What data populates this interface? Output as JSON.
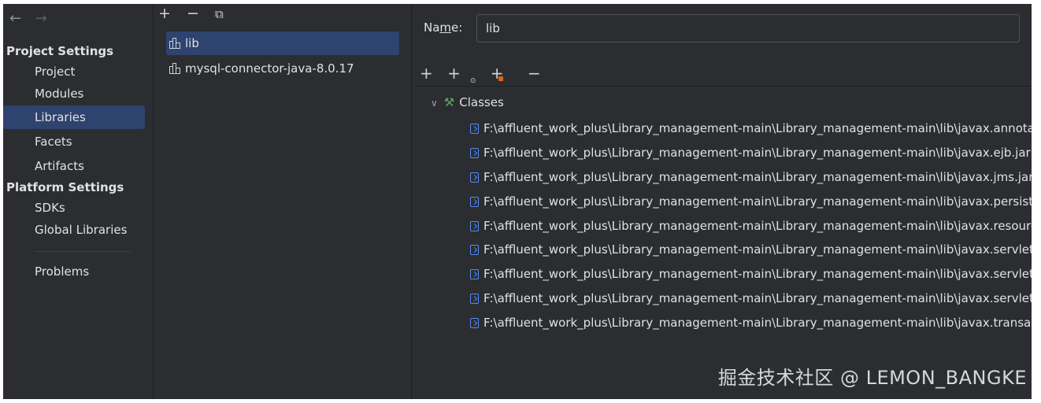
{
  "nav": {
    "back_icon": "arrow-left-icon",
    "forward_icon": "arrow-right-icon",
    "back_glyph": "←",
    "forward_glyph": "→",
    "project_settings_header": "Project Settings",
    "project_items": [
      {
        "label": "Project"
      },
      {
        "label": "Modules"
      },
      {
        "label": "Libraries",
        "selected": true
      },
      {
        "label": "Facets"
      },
      {
        "label": "Artifacts"
      }
    ],
    "platform_settings_header": "Platform Settings",
    "platform_items": [
      {
        "label": "SDKs"
      },
      {
        "label": "Global Libraries"
      }
    ],
    "problems_label": "Problems"
  },
  "libraries": {
    "toolbar": {
      "add": "+",
      "remove": "−",
      "copy": "⧉"
    },
    "items": [
      {
        "label": "lib",
        "selected": true
      },
      {
        "label": "mysql-connector-java-8.0.17"
      }
    ]
  },
  "detail": {
    "name_label_prefix": "Na",
    "name_label_mnemonic": "m",
    "name_label_suffix": "e:",
    "name_value": "lib",
    "toolbar": {
      "add": "+",
      "add_special": "+",
      "add_jar": "+",
      "remove": "−"
    },
    "classes_label": "Classes",
    "classes": [
      "F:\\affluent_work_plus\\Library_management-main\\Library_management-main\\lib\\javax.annotat",
      "F:\\affluent_work_plus\\Library_management-main\\Library_management-main\\lib\\javax.ejb.jar",
      "F:\\affluent_work_plus\\Library_management-main\\Library_management-main\\lib\\javax.jms.jar",
      "F:\\affluent_work_plus\\Library_management-main\\Library_management-main\\lib\\javax.persiste",
      "F:\\affluent_work_plus\\Library_management-main\\Library_management-main\\lib\\javax.resourc",
      "F:\\affluent_work_plus\\Library_management-main\\Library_management-main\\lib\\javax.servlet.",
      "F:\\affluent_work_plus\\Library_management-main\\Library_management-main\\lib\\javax.servlet.",
      "F:\\affluent_work_plus\\Library_management-main\\Library_management-main\\lib\\javax.servlet.",
      "F:\\affluent_work_plus\\Library_management-main\\Library_management-main\\lib\\javax.transac"
    ]
  },
  "watermark": "掘金技术社区 @ LEMON_BANGKE",
  "colors": {
    "background": "#2b2d30",
    "selection": "#2e436e",
    "text": "#dfe1e5",
    "jar_icon": "#548af7",
    "hammer_icon": "#5fa860",
    "orange_accent": "#d9661c"
  }
}
